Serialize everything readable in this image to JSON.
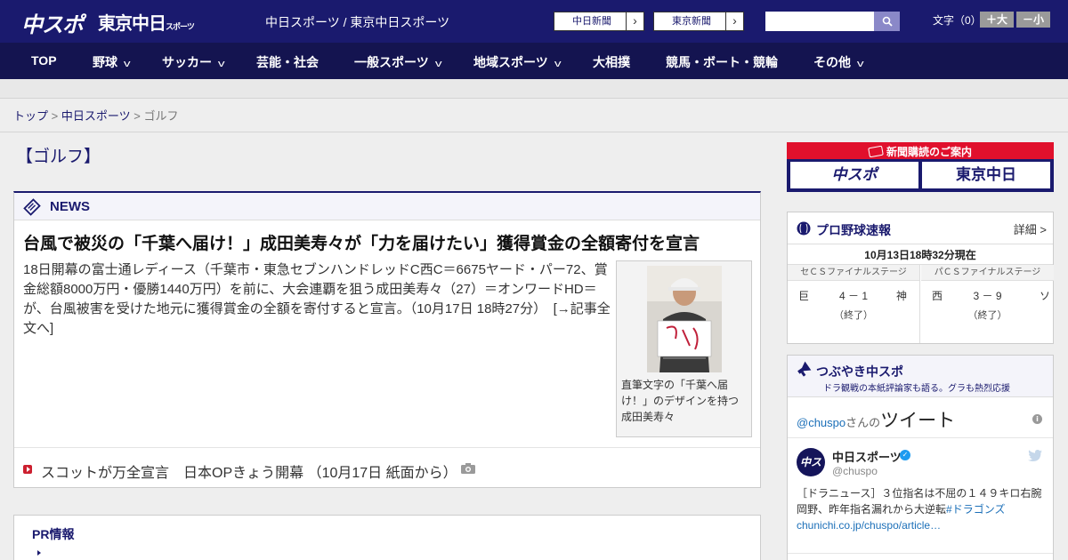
{
  "header": {
    "logo_main": "中スポ",
    "logo_tokyo": "東京中日",
    "logo_tokyo_small": "スポーツ",
    "site_title": "中日スポーツ / 東京中日スポーツ",
    "btn_chunichi": "中日新聞",
    "btn_tokyo": "東京新聞",
    "search_placeholder": "",
    "font_label": "文字（0）",
    "font_plus": "＋大",
    "font_minus": "－小"
  },
  "nav": {
    "items": [
      {
        "label": "TOP",
        "has_menu": false
      },
      {
        "label": "野球",
        "has_menu": true
      },
      {
        "label": "サッカー",
        "has_menu": true
      },
      {
        "label": "芸能・社会",
        "has_menu": false
      },
      {
        "label": "一般スポーツ",
        "has_menu": true
      },
      {
        "label": "地域スポーツ",
        "has_menu": true
      },
      {
        "label": "大相撲",
        "has_menu": false
      },
      {
        "label": "競馬・ボート・競輪",
        "has_menu": false
      },
      {
        "label": "その他",
        "has_menu": true
      }
    ]
  },
  "breadcrumb": {
    "home": "トップ",
    "sep": ">",
    "section": "中日スポーツ",
    "current": "ゴルフ"
  },
  "page": {
    "heading": "【ゴルフ】"
  },
  "news": {
    "title": "NEWS",
    "headline": "台風で被災の「千葉へ届け！」成田美寿々が「力を届けたい」獲得賞金の全額寄付を宣言",
    "body": "18日開幕の富士通レディース（千葉市・東急セブンハンドレッドC西C＝6675ヤード・パー72、賞金総額8000万円・優勝1440万円）を前に、大会連覇を狙う成田美寿々（27）＝オンワードHD＝が、台風被害を受けた地元に獲得賞金の全額を寄付すると宣言。（10月17日 18時27分）　[→記事全文へ]",
    "photo_caption": "直筆文字の「千葉へ届け！」のデザインを持つ成田美寿々",
    "related": "スコットが万全宣言　日本OPきょう開幕 （10月17日 紙面から）"
  },
  "pr": {
    "title": "PR情報"
  },
  "sidebar": {
    "subscription": {
      "title": "新聞購読のご案内",
      "logo1": "中スポ",
      "logo2": "東京中日"
    },
    "baseball": {
      "title": "プロ野球速報",
      "detail": "詳細 >",
      "time": "10月13日18時32分現在",
      "games": [
        {
          "stage": "セＣＳファイナルステージ",
          "home": "巨",
          "score": "4 － 1",
          "away": "神",
          "status": "（終了）"
        },
        {
          "stage": "パＣＳファイナルステージ",
          "home": "西",
          "score": "3 － 9",
          "away": "ソ",
          "status": "（終了）"
        }
      ]
    },
    "tweets": {
      "title": "つぶやき中スポ",
      "subtitle": "ドラ観戦の本紙評論家も語る。グラも熱烈応援",
      "handle_link": "@chuspo",
      "handle_suffix": "さんの",
      "tweet_word": "ツイート",
      "info": "i",
      "avatar_text": "中スポ",
      "name": "中日スポーツ",
      "verified": "✓",
      "handle": "@chuspo",
      "text_plain": "［ドラニュース］３位指名は不屈の１４９キロ右腕　岡野、昨年指名漏れから大逆転",
      "text_link": "#ドラゴンズchunichi.co.jp/chuspo/article…"
    }
  },
  "colors": {
    "brand_navy": "#1a1a6e",
    "nav_navy": "#141450",
    "accent_red": "#e0102c",
    "link_blue": "#1b6fb8"
  }
}
